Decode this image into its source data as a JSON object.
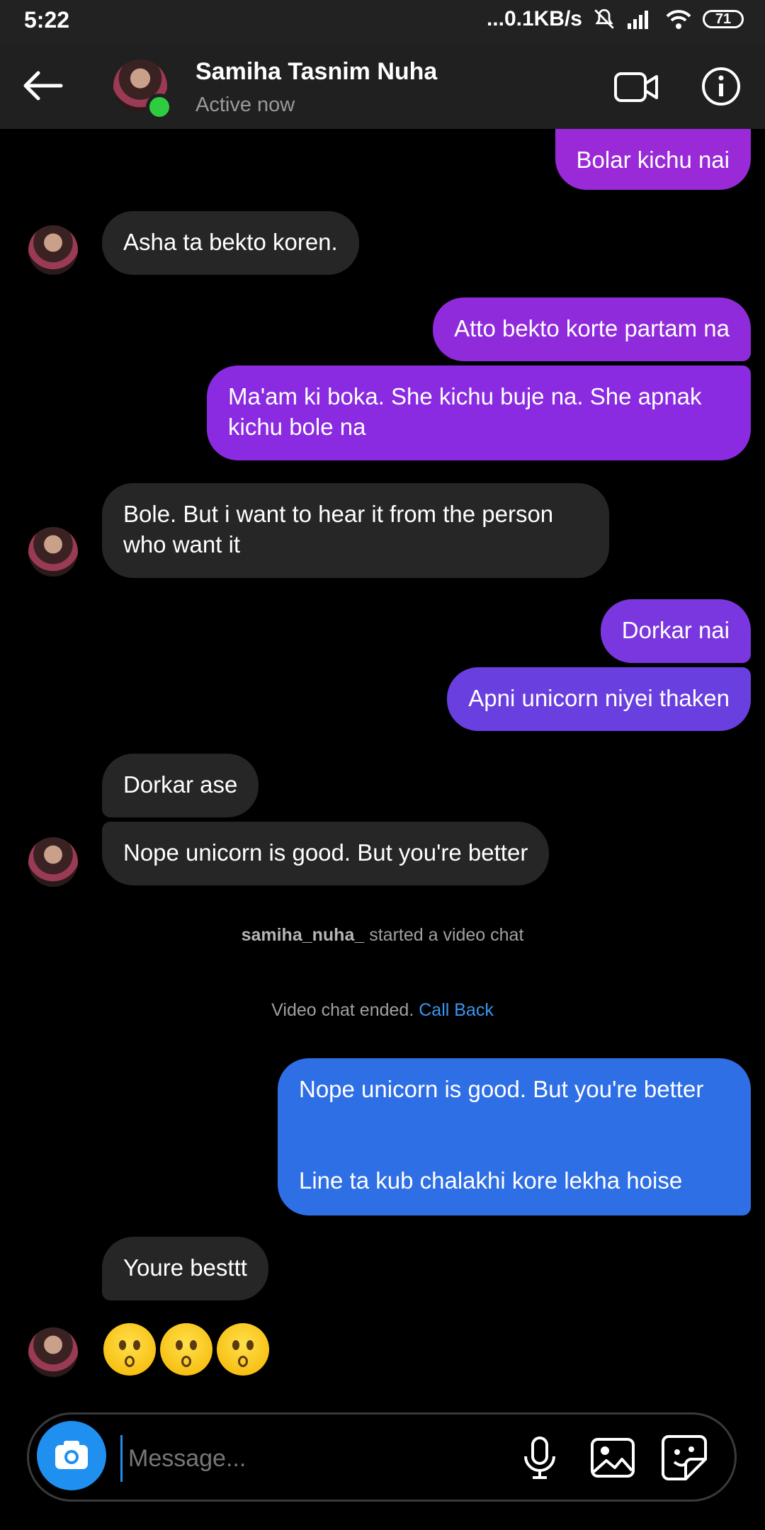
{
  "status_bar": {
    "time": "5:22",
    "network_speed": "...0.1KB/s",
    "battery": "71"
  },
  "header": {
    "name": "Samiha Tasnim Nuha",
    "status": "Active now",
    "back_icon": "arrow-left-icon",
    "video_icon": "video-camera-icon",
    "info_icon": "info-icon"
  },
  "messages": {
    "m1": "Bolar kichu nai",
    "m2": "Asha ta bekto koren.",
    "m3": "Atto bekto korte partam na",
    "m4": "Ma'am ki boka. She kichu buje na. She apnak kichu bole na",
    "m5": "Bole. But i want to hear it from the person who want it",
    "m6": "Dorkar nai",
    "m7": "Apni unicorn niyei thaken",
    "m8": "Dorkar ase",
    "m9": "Nope unicorn is good. But you're better",
    "m10_line1": "Nope unicorn is good. But you're better",
    "m10_line2": "Line ta kub chalakhi kore lekha hoise",
    "m11": "Youre besttt"
  },
  "system": {
    "video_user": "samiha_nuha_",
    "video_started": "started a video chat",
    "video_ended": "Video chat ended.",
    "call_back": "Call Back"
  },
  "composer": {
    "placeholder": "Message...",
    "camera_icon": "camera-icon",
    "mic_icon": "microphone-icon",
    "gallery_icon": "image-icon",
    "sticker_icon": "sticker-icon"
  },
  "colors": {
    "bubble_purple": "#8a2be2",
    "bubble_violet": "#6a3fe0",
    "bubble_blue": "#2f6fe6",
    "incoming": "#262626",
    "link": "#3897f0"
  }
}
